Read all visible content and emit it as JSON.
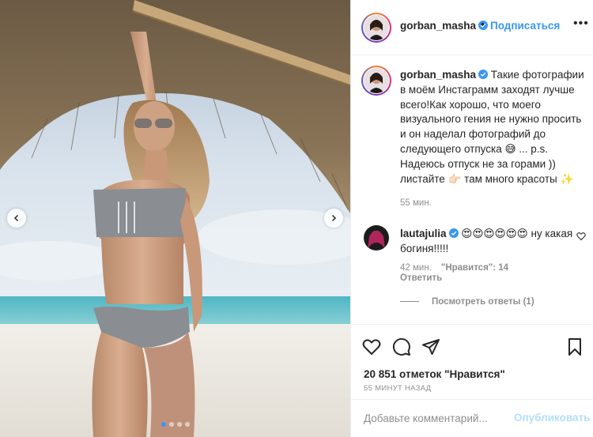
{
  "post": {
    "username": "gorban_masha",
    "header_separator": "•",
    "follow_label": "Подписаться",
    "more_label": "•••",
    "caption": "Такие фотографии в моём Инстаграмм заходят лучше всего!Как хорошо, что моего визуального гения не нужно просить и он наделал фотографий до следующего отпуска 😅 ... p.s. Надеюсь отпуск не за горами )) листайте 👉🏻 там много красоты ✨",
    "caption_time": "55 мин.",
    "likes": "20 851 отметок \"Нравится\"",
    "time_ago": "55 минут назад"
  },
  "comment": {
    "username": "lautajulia",
    "text": "😍😍😍😍😍😍 ну какая богиня!!!!!",
    "time": "42 мин.",
    "likes": "\"Нравится\": 14",
    "reply_label": "Ответить",
    "view_replies_label": "Посмотреть ответы (1)"
  },
  "add_comment": {
    "placeholder": "Добавьте комментарий...",
    "publish_label": "Опубликовать"
  },
  "carousel": {
    "slide_count": 4,
    "active_slide": 1
  },
  "icons": {
    "like": "heart-icon",
    "comment": "comment-icon",
    "share": "paper-plane-icon",
    "save": "bookmark-icon",
    "verified": "verified-badge-icon"
  },
  "colors": {
    "accent": "#3897f0",
    "publish_disabled": "#b2dffc",
    "muted": "#8e8e8e",
    "text": "#262626",
    "border": "#efefef"
  }
}
